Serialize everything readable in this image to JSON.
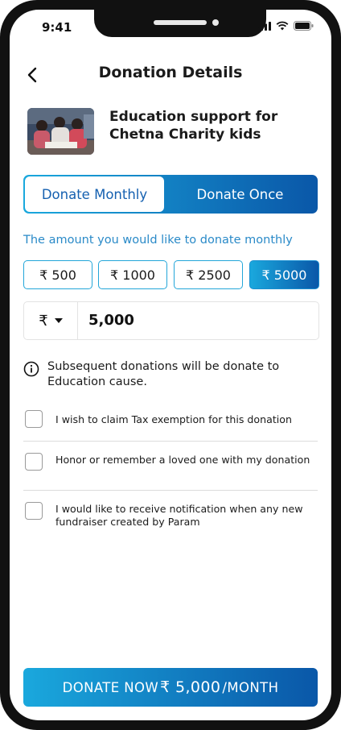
{
  "status_bar": {
    "time": "9:41"
  },
  "header": {
    "title": "Donation Details"
  },
  "cause": {
    "title": "Education support for Chetna Charity kids"
  },
  "donate_toggle": {
    "monthly_label": "Donate Monthly",
    "once_label": "Donate Once",
    "selected": "monthly"
  },
  "amount": {
    "label": "The amount you would like to donate monthly",
    "options": [
      "₹ 500",
      "₹ 1000",
      "₹ 2500",
      "₹ 5000"
    ],
    "selected_index": 3,
    "currency_symbol": "₹",
    "value": "5,000"
  },
  "info": {
    "text": "Subsequent donations will be donate to Education cause."
  },
  "checkboxes": [
    {
      "label": "I wish to claim Tax exemption for this donation",
      "checked": false
    },
    {
      "label": "Honor or remember a loved one with my donation",
      "checked": false
    },
    {
      "label": "I would like to receive notification when any new fundraiser created by Param",
      "checked": false
    }
  ],
  "cta": {
    "prefix": "DONATE NOW",
    "amount": "₹ 5,000",
    "suffix": "/MONTH"
  },
  "colors": {
    "accent_start": "#1aa8dd",
    "accent_end": "#0a57a8",
    "label_blue": "#2a8ac8"
  }
}
